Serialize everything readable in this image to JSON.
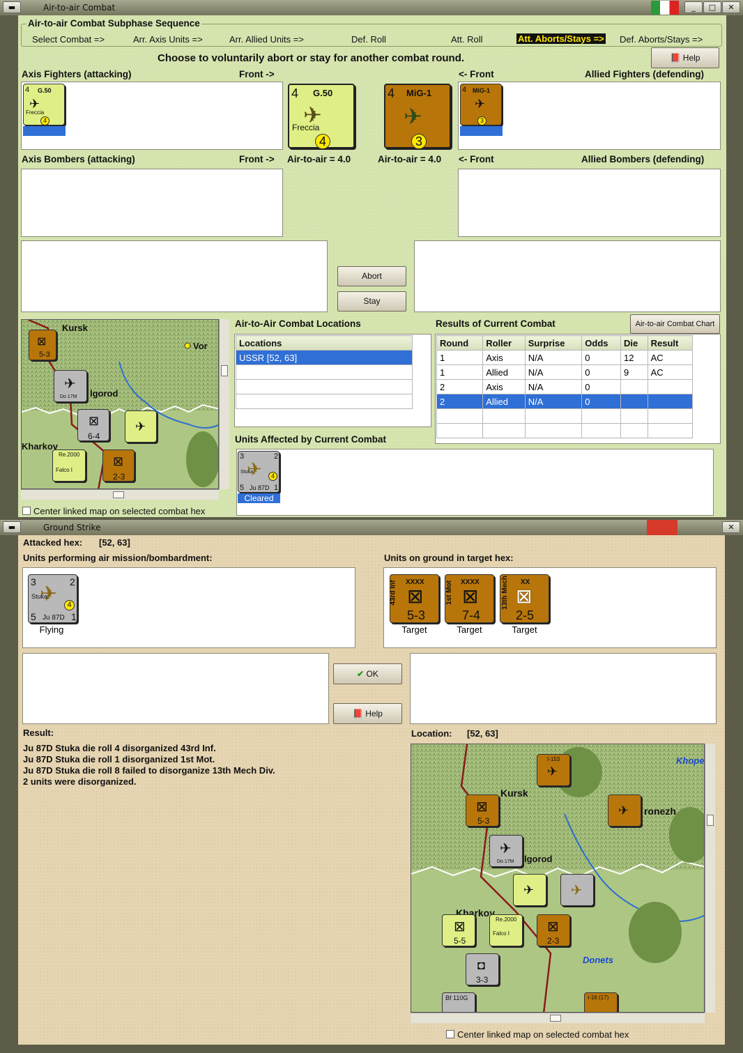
{
  "aa": {
    "title": "Air-to-air Combat",
    "seq_title": "Air-to-air Combat Subphase Sequence",
    "phases": [
      "Select Combat =>",
      "Arr. Axis Units =>",
      "Arr. Allied Units =>",
      "Def. Roll",
      "Att. Roll",
      "Att. Aborts/Stays =>",
      "Def. Aborts/Stays =>"
    ],
    "instruction": "Choose to voluntarily abort or stay for another combat round.",
    "help": "Help",
    "axis_fighters": "Axis Fighters (attacking)",
    "front_right": "Front ->",
    "front_left": "<- Front",
    "allied_fighters": "Allied Fighters (defending)",
    "axis_bombers": "Axis Bombers (attacking)",
    "allied_bombers": "Allied Bombers (defending)",
    "axis_a2a": "Air-to-air = 4.0",
    "allied_a2a": "Air-to-air = 4.0",
    "abort": "Abort",
    "stay": "Stay",
    "locations_title": "Air-to-Air Combat Locations",
    "locations_header": "Locations",
    "locations": [
      "USSR [52, 63]"
    ],
    "results_title": "Results of Current Combat",
    "chart_btn": "Air-to-air Combat Chart",
    "results_headers": [
      "Round",
      "Roller",
      "Surprise",
      "Odds",
      "Die",
      "Result"
    ],
    "results_rows": [
      [
        "1",
        "Axis",
        "N/A",
        "0",
        "12",
        "AC"
      ],
      [
        "1",
        "Allied",
        "N/A",
        "0",
        "9",
        "AC"
      ],
      [
        "2",
        "Axis",
        "N/A",
        "0",
        "",
        ""
      ],
      [
        "2",
        "Allied",
        "N/A",
        "0",
        "",
        ""
      ]
    ],
    "affected_title": "Units Affected by Current Combat",
    "affected_status": "Cleared",
    "center_map": "Center linked map on selected combat hex"
  },
  "units": {
    "g50": {
      "top": "4",
      "name": "G.50",
      "sub": "Freccia",
      "val": "4"
    },
    "mig1": {
      "top": "4",
      "name": "MiG-1",
      "val": "3"
    },
    "stuka": {
      "tl": "3",
      "tr": "2",
      "name": "Stuka",
      "val": "4",
      "bl": "5",
      "model": "Ju 87D",
      "br": "1"
    },
    "t43": {
      "size": "XXXX",
      "side": "43rd Inf",
      "str": "5-3",
      "status": "Target"
    },
    "t1m": {
      "size": "XXXX",
      "side": "1st Mot",
      "str": "7-4",
      "status": "Target"
    },
    "t13": {
      "size": "XX",
      "side": "13th Mech",
      "str": "2-5",
      "status": "Target"
    },
    "flying": "Flying"
  },
  "gs": {
    "title": "Ground Strike",
    "attacked_hex_label": "Attacked hex:",
    "attacked_hex": "[52, 63]",
    "air_units": "Units performing air mission/bombardment:",
    "ground_units": "Units on ground in target hex:",
    "ok": "OK",
    "help": "Help",
    "result_label": "Result:",
    "results": [
      "Ju 87D Stuka die roll 4 disorganized 43rd Inf.",
      "Ju 87D Stuka die roll 1 disorganized 1st Mot.",
      "Ju 87D Stuka die roll 8 failed to disorganize 13th Mech Div.",
      "2 units were disorganized."
    ],
    "location_label": "Location:",
    "location": "[52, 63]",
    "center_map": "Center linked map on selected combat hex"
  },
  "map": {
    "kursk": "Kursk",
    "belgorod": "lgorod",
    "kharkov": "Kharkov",
    "voronezh": "ronezh",
    "donets": "Donets",
    "khoper": "Khope",
    "vor": "Vor",
    "do17": "Do 17M",
    "re2000": "Re.2000",
    "falco": "Falco I",
    "bf110": "Bf 110G",
    "i153": "I-153",
    "i16": "I-16 (17)",
    "s53": "5-3",
    "s64": "6-4",
    "s23": "2-3",
    "s55": "5-5",
    "s33": "3-3"
  },
  "colors": {
    "green_panel": "#d6e4b0",
    "tan_panel": "#e6d5b2",
    "selection": "#2f6fd6",
    "axis_counter": "#dfef86",
    "soviet_counter": "#b8760a"
  },
  "icons": [
    "menu-icon",
    "minimize-icon",
    "maximize-icon",
    "close-icon",
    "help-book-icon",
    "check-icon",
    "fighter-plane-icon",
    "bomber-plane-icon",
    "infantry-symbol-icon",
    "motorized-symbol-icon",
    "mech-symbol-icon",
    "italian-flag-icon"
  ]
}
